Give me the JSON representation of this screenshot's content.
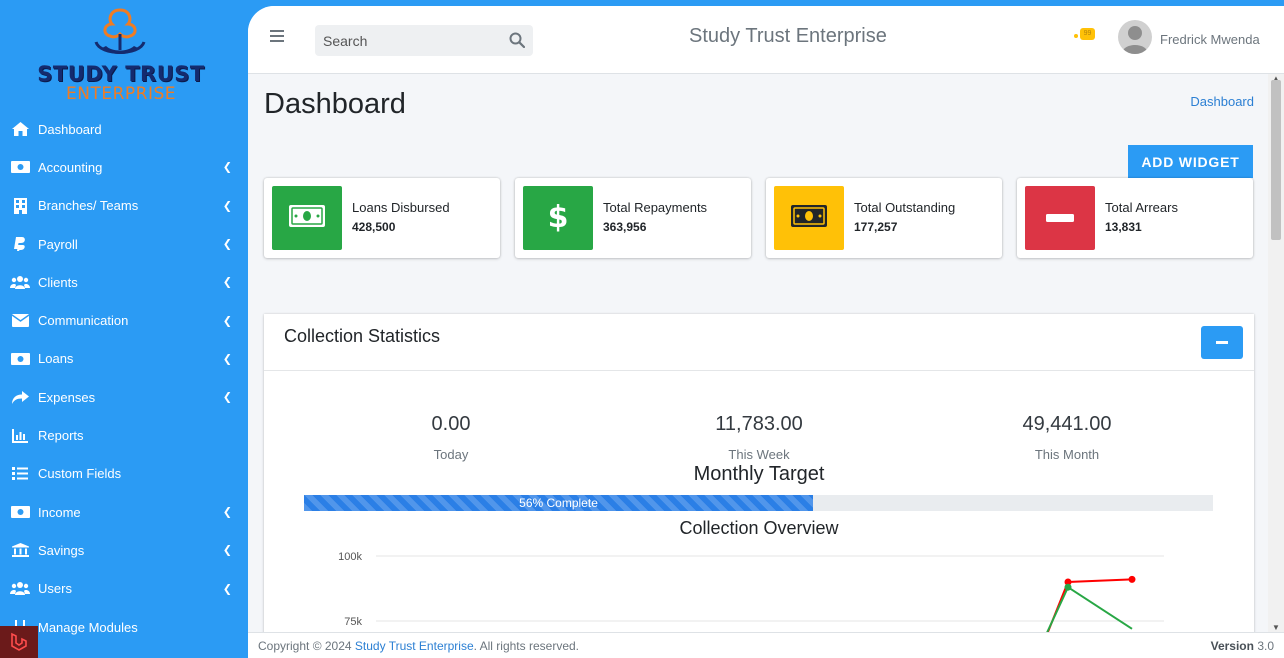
{
  "brand": {
    "logo_line1": "STUDY TRUST",
    "logo_line2": "ENTERPRISE"
  },
  "sidebar": {
    "items": [
      {
        "label": "Dashboard",
        "icon": "home-icon",
        "has_submenu": false
      },
      {
        "label": "Accounting",
        "icon": "money-icon",
        "has_submenu": true
      },
      {
        "label": "Branches/ Teams",
        "icon": "building-icon",
        "has_submenu": true
      },
      {
        "label": "Payroll",
        "icon": "paypal-icon",
        "has_submenu": true
      },
      {
        "label": "Clients",
        "icon": "users-icon",
        "has_submenu": true
      },
      {
        "label": "Communication",
        "icon": "envelope-icon",
        "has_submenu": true
      },
      {
        "label": "Loans",
        "icon": "money-icon",
        "has_submenu": true
      },
      {
        "label": "Expenses",
        "icon": "share-icon",
        "has_submenu": true
      },
      {
        "label": "Reports",
        "icon": "chart-bar-icon",
        "has_submenu": false
      },
      {
        "label": "Custom Fields",
        "icon": "list-icon",
        "has_submenu": false
      },
      {
        "label": "Income",
        "icon": "money-icon",
        "has_submenu": true
      },
      {
        "label": "Savings",
        "icon": "bank-icon",
        "has_submenu": true
      },
      {
        "label": "Users",
        "icon": "users-icon",
        "has_submenu": true
      },
      {
        "label": "Manage Modules",
        "icon": "modules-icon",
        "has_submenu": false
      }
    ]
  },
  "topbar": {
    "search_placeholder": "Search",
    "app_title": "Study Trust Enterprise",
    "notification_badge": "99",
    "user_name": "Fredrick Mwenda"
  },
  "page": {
    "title": "Dashboard",
    "breadcrumb": "Dashboard",
    "add_widget_label": "ADD WIDGET"
  },
  "cards": [
    {
      "label": "Loans Disbursed",
      "value": "428,500",
      "color": "#28a745",
      "icon": "money-bill-icon"
    },
    {
      "label": "Total Repayments",
      "value": "363,956",
      "color": "#28a745",
      "icon": "dollar-icon"
    },
    {
      "label": "Total Outstanding",
      "value": "177,257",
      "color": "#ffc107",
      "icon": "money-bill-icon"
    },
    {
      "label": "Total Arrears",
      "value": "13,831",
      "color": "#dc3545",
      "icon": "minus-icon"
    }
  ],
  "collection": {
    "title": "Collection Statistics",
    "metrics": [
      {
        "value": "0.00",
        "label": "Today"
      },
      {
        "value": "11,783.00",
        "label": "This Week"
      },
      {
        "value": "49,441.00",
        "label": "This Month"
      }
    ],
    "target_title": "Monthly Target",
    "progress_percent": 56,
    "progress_label": "56% Complete",
    "overview_title": "Collection Overview"
  },
  "chart_data": {
    "type": "line",
    "title": "Collection Overview",
    "y_ticks": [
      "100k",
      "75k"
    ],
    "ylim": [
      75000,
      100000
    ],
    "series": [
      {
        "color": "#ff0000",
        "values": [
          67000,
          90000,
          91000
        ]
      },
      {
        "color": "#28a745",
        "values": [
          68000,
          88000,
          72000
        ]
      }
    ]
  },
  "footer": {
    "copyright_prefix": "Copyright © 2024",
    "company": "Study Trust Enterprise",
    "rights": ". All rights reserved.",
    "version_label": "Version",
    "version": "3.0"
  },
  "colors": {
    "accent": "#2b9bf4",
    "link": "#2b7fd3"
  }
}
